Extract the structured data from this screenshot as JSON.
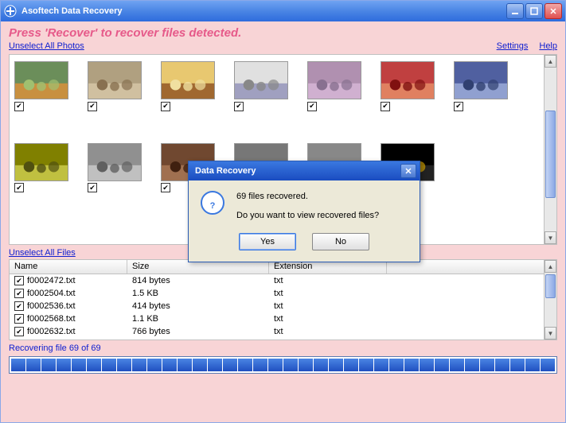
{
  "window": {
    "title": "Asoftech Data Recovery"
  },
  "hint": "Press 'Recover' to recover files detected.",
  "links": {
    "unselect_photos": "Unselect All Photos",
    "unselect_files": "Unselect All Files",
    "settings": "Settings",
    "help": "Help"
  },
  "photos": {
    "count": 13
  },
  "file_table": {
    "headers": {
      "name": "Name",
      "size": "Size",
      "ext": "Extension"
    },
    "rows": [
      {
        "name": "f0002472.txt",
        "size": "814 bytes",
        "ext": "txt"
      },
      {
        "name": "f0002504.txt",
        "size": "1.5 KB",
        "ext": "txt"
      },
      {
        "name": "f0002536.txt",
        "size": "414 bytes",
        "ext": "txt"
      },
      {
        "name": "f0002568.txt",
        "size": "1.1 KB",
        "ext": "txt"
      },
      {
        "name": "f0002632.txt",
        "size": "766 bytes",
        "ext": "txt"
      }
    ]
  },
  "status_text": "Recovering file 69 of 69",
  "progress_segments": 36,
  "dialog": {
    "title": "Data Recovery",
    "line1": "69 files recovered.",
    "line2": "Do you want to view recovered files?",
    "yes": "Yes",
    "no": "No"
  }
}
